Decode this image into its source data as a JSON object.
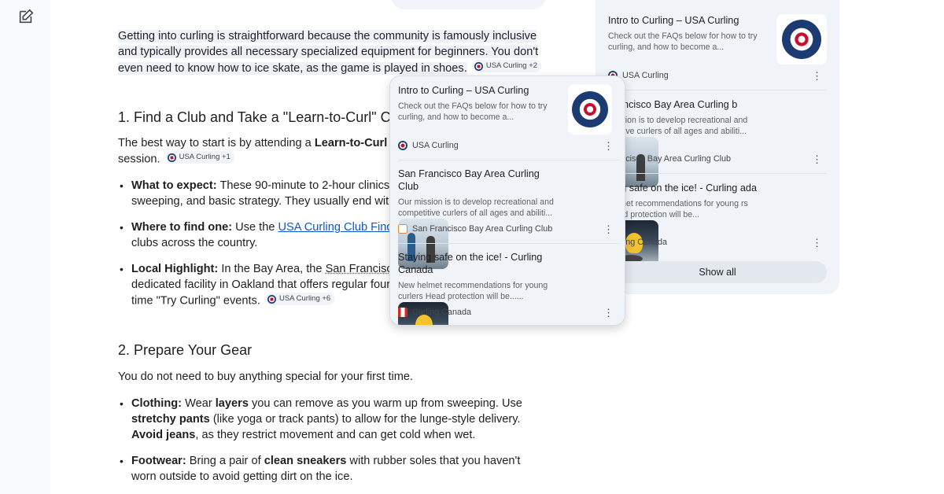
{
  "rail": {
    "edit_icon": "edit-square-icon"
  },
  "article": {
    "intro": "Getting into curling is straightforward because the community is famously inclusive and typically provides all necessary specialized equipment for beginners. You don't even need to know how to ice skate, as the game is played in shoes.",
    "intro_chip": "USA Curling +2",
    "section1_heading": "1. Find a Club and Take a \"Learn-to-Curl\" Cla",
    "s1_p_pre": "The best way to start is by attending a ",
    "s1_p_bold": "Learn-to-Curl (LT",
    "s1_p_end": "session.",
    "s1_chip": "USA Curling +1",
    "b1_bold": "What to expect:",
    "b1_text": " These 90-minute to 2-hour clinics co",
    "b1_line2": "sweeping, and basic strategy. They usually end with a s",
    "b2_bold": "Where to find one:",
    "b2_pre": " Use the ",
    "b2_link": "USA Curling Club Finder",
    "b2_post": " to",
    "b2_line2": "clubs across the country.",
    "b3_bold": "Local Highlight:",
    "b3_pre": " In the Bay Area, the ",
    "b3_link": "San Francisco Ba",
    "b3_line2": "dedicated facility in Oakland that offers regular four-w",
    "b3_line3": "time \"Try Curling\" events.",
    "b3_chip": "USA Curling +6",
    "section2_heading": "2. Prepare Your Gear",
    "s2_p": "You do not need to buy anything special for your first time.",
    "c_bold": "Clothing:",
    "c_t1": " Wear ",
    "c_b2": "layers",
    "c_t2": " you can remove as you warm up from sweeping. Use ",
    "c_b3": "stretchy pants",
    "c_t3": " (like yoga or track pants) to allow for the lunge-style delivery. ",
    "c_b4": "Avoid jeans",
    "c_t4": ", as they restrict movement and can get cold when wet.",
    "f_bold": "Footwear:",
    "f_t1": " Bring a pair of ",
    "f_b2": "clean sneakers",
    "f_t2": " with rubber soles that you haven't worn outside to avoid getting dirt on the ice."
  },
  "sources": [
    {
      "title": "Intro to Curling – USA Curling",
      "desc": "Check out the FAQs below for how to try curling, and how to become a...",
      "site": "USA Curling"
    },
    {
      "title": "San Francisco Bay Area Curling Club",
      "desc": "Our mission is to develop recreational and competitive curlers of all ages and abiliti...",
      "site": "San Francisco Bay Area Curling Club"
    },
    {
      "title": "Staying safe on the ice! - Curling Canada",
      "desc": "New helmet recommendations for young curlers Head protection will be......",
      "site": "Curling Canada"
    }
  ],
  "side_panel": {
    "items": [
      {
        "title": "Intro to Curling – USA Curling",
        "desc": "Check out the FAQs below for how to try curling, and how to become a...",
        "site": "USA Curling"
      },
      {
        "title": "Francisco Bay Area Curling b",
        "desc": "mission is to develop recreational and petitive curlers of all ages and abiliti...",
        "site": "Francisco Bay Area Curling Club"
      },
      {
        "title": "ying safe on the ice! - Curling ada",
        "desc": "helmet recommendations for young rs Head protection will be...",
        "site": "Curling Canada"
      }
    ],
    "show_all": "Show all"
  },
  "icons": {
    "more": "⋮"
  }
}
